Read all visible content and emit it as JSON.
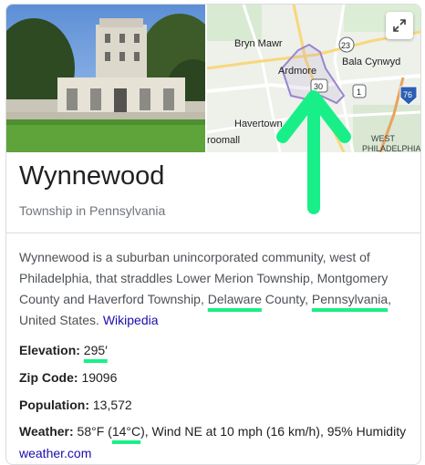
{
  "place": {
    "title": "Wynnewood",
    "subtitle": "Township in Pennsylvania"
  },
  "map": {
    "labels": {
      "bryn_mawr": "Bryn Mawr",
      "ardmore": "Ardmore",
      "bala_cynwyd": "Bala Cynwyd",
      "havertown": "Havertown",
      "roomall": "roomall",
      "west": "WEST",
      "philadelphia": "PHILADELPHIA",
      "route_23": "23",
      "route_30": "30",
      "route_1": "1",
      "route_76": "76"
    },
    "expand_icon": "expand-icon"
  },
  "description": {
    "part1": "Wynnewood is a suburban unincorporated community, west of Philadelphia, that straddles Lower Merion Township, Montgomery County and Haverford Township, ",
    "delaware": "Delaware",
    "part2": " County, ",
    "pennsylvania": "Pennsylvania",
    "part3": ", United States. ",
    "source": "Wikipedia"
  },
  "facts": {
    "elevation_label": "Elevation:",
    "elevation_value": "295′",
    "zip_label": "Zip Code:",
    "zip_value": "19096",
    "population_label": "Population:",
    "population_value": "13,572",
    "weather_label": "Weather:",
    "weather_pre": "58°F (",
    "weather_c": "14°C",
    "weather_post": "), Wind NE at 10 mph (16 km/h), 95% Humidity",
    "weather_source": "weather.com"
  },
  "colors": {
    "annotation": "#19ef88",
    "link": "#1a0dab"
  }
}
